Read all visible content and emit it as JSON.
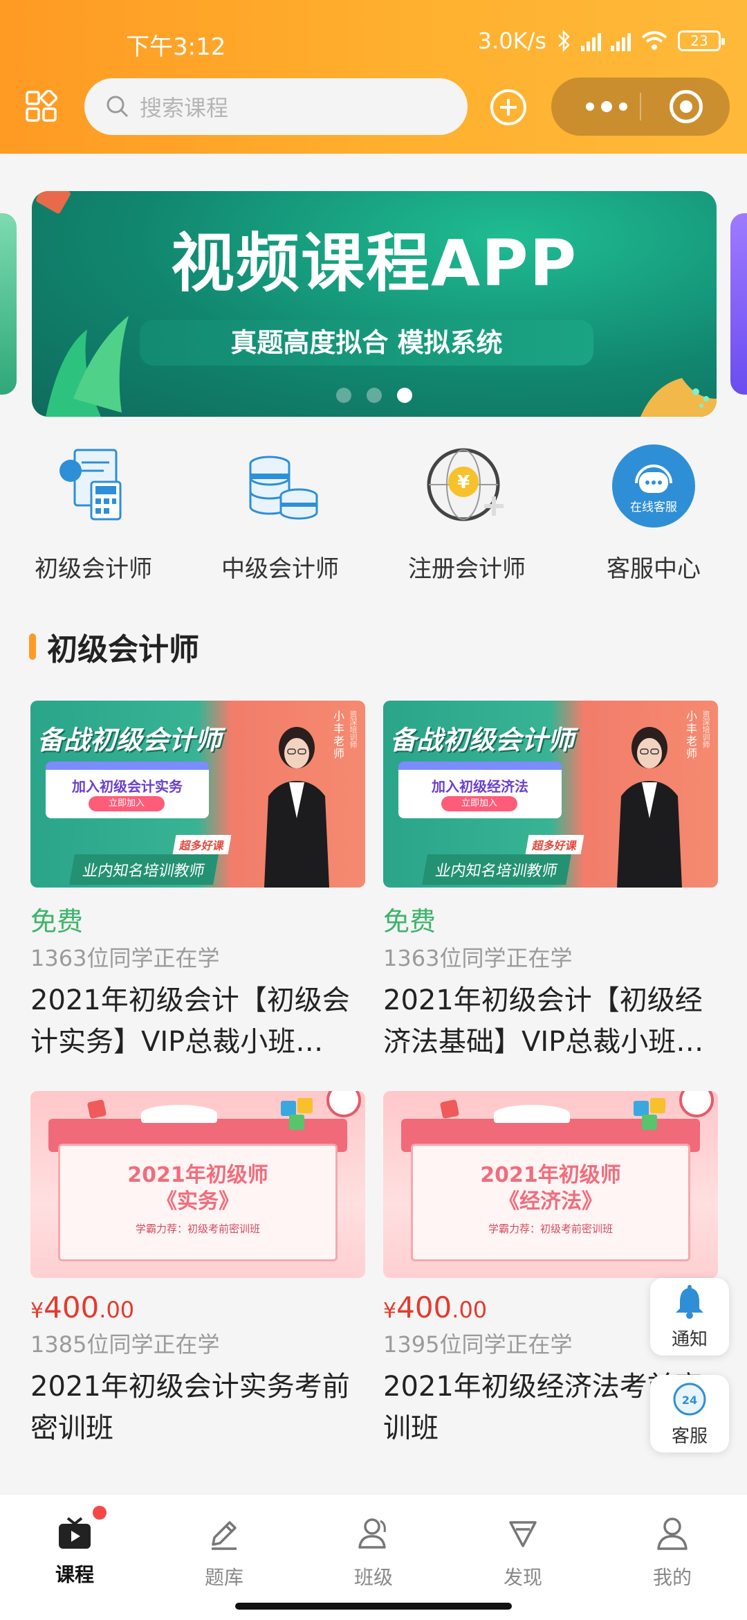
{
  "status_bar": {
    "time": "下午3:12",
    "net_speed": "3.0K/s",
    "battery": "23"
  },
  "header": {
    "search_placeholder": "搜索课程"
  },
  "banner": {
    "title": "视频课程APP",
    "subtitle": "真题高度拟合 模拟系统",
    "active_dot": 3,
    "dot_count": 3
  },
  "categories": [
    {
      "label": "初级会计师",
      "icon": "calculator-document-icon"
    },
    {
      "label": "中级会计师",
      "icon": "coins-stack-icon"
    },
    {
      "label": "注册会计师",
      "icon": "yen-globe-icon"
    },
    {
      "label": "客服中心",
      "icon": "online-service-headset-icon",
      "badge_text": "在线客服"
    }
  ],
  "section": {
    "title": "初级会计师"
  },
  "courses": [
    {
      "price_label": "免费",
      "learners": "1363位同学正在学",
      "name": "2021年初级会计【初级会计实务】VIP总裁小班…",
      "thumb": {
        "headline": "备战初级会计师",
        "box_title": "加入初级会计实务",
        "box_button": "立即加入",
        "tag_small": "超多好课",
        "tag_big": "业内知名培训教师",
        "teacher": "小丰老师",
        "teacher_sub": "资深培训师"
      }
    },
    {
      "price_label": "免费",
      "learners": "1363位同学正在学",
      "name": "2021年初级会计【初级经济法基础】VIP总裁小班…",
      "thumb": {
        "headline": "备战初级会计师",
        "box_title": "加入初级经济法",
        "box_button": "立即加入",
        "tag_small": "超多好课",
        "tag_big": "业内知名培训教师",
        "teacher": "小丰老师",
        "teacher_sub": "资深培训师"
      }
    },
    {
      "price": {
        "currency": "¥",
        "int": "400",
        "dec": ".00"
      },
      "learners": "1385位同学正在学",
      "name": "2021年初级会计实务考前密训班",
      "thumb": {
        "line1": "2021年初级师",
        "line2": "《实务》",
        "line3": "学霸力荐：初级考前密训班"
      }
    },
    {
      "price": {
        "currency": "¥",
        "int": "400",
        "dec": ".00"
      },
      "learners": "1395位同学正在学",
      "name": "2021年初级经济法考前密训班",
      "thumb": {
        "line1": "2021年初级师",
        "line2": "《经济法》",
        "line3": "学霸力荐：初级考前密训班"
      }
    }
  ],
  "floating": {
    "notify": "通知",
    "service": "客服"
  },
  "tabbar": [
    {
      "label": "课程",
      "icon": "video-course-icon",
      "active": true
    },
    {
      "label": "题库",
      "icon": "pencil-icon",
      "active": false
    },
    {
      "label": "班级",
      "icon": "class-people-icon",
      "active": false
    },
    {
      "label": "发现",
      "icon": "discover-diamond-icon",
      "active": false
    },
    {
      "label": "我的",
      "icon": "profile-icon",
      "active": false
    }
  ],
  "colors": {
    "header_orange": "#ff9a23",
    "price_red": "#e53a2d",
    "free_green": "#3bb56a"
  }
}
